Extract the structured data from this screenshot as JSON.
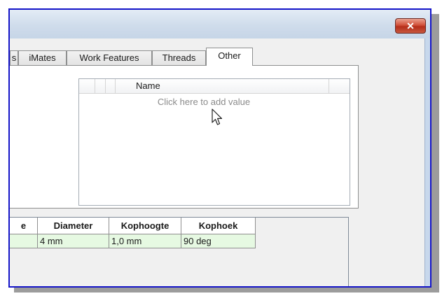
{
  "window": {
    "close_glyph": "✕",
    "close_color": "#c8463a",
    "frame_color": "#1414c8"
  },
  "tabs": [
    {
      "label": "s"
    },
    {
      "label": "iMates"
    },
    {
      "label": "Work Features"
    },
    {
      "label": "Threads"
    },
    {
      "label": "Other",
      "active": true
    }
  ],
  "grid": {
    "column_header": "Name",
    "add_value_text": "Click here to add value"
  },
  "table": {
    "headers": [
      "e",
      "Diameter",
      "Kophoogte",
      "Kophoek"
    ],
    "row": [
      "",
      "4 mm",
      "1,0 mm",
      "90 deg"
    ],
    "row_color": "#e6f9e2"
  },
  "icons": {
    "cursor": "mouse-pointer-icon",
    "close": "close-icon"
  }
}
